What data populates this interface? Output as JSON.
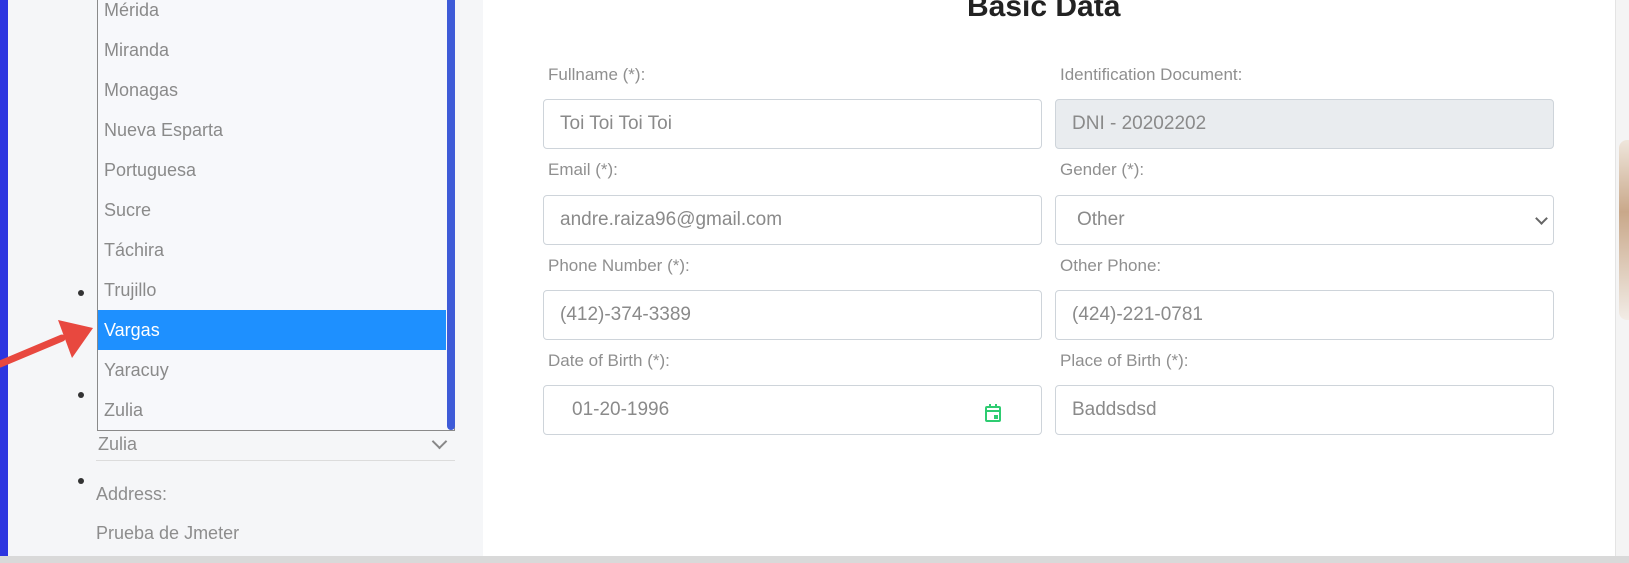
{
  "dropdown": {
    "options": [
      "Mérida",
      "Miranda",
      "Monagas",
      "Nueva Esparta",
      "Portuguesa",
      "Sucre",
      "Táchira",
      "Trujillo",
      "Vargas",
      "Yaracuy",
      "Zulia"
    ],
    "selected": "Vargas"
  },
  "sidebar": {
    "state_select_value": "Zulia",
    "address_label": "Address:",
    "address_value": "Prueba de Jmeter"
  },
  "form": {
    "title": "Basic Data",
    "fullname": {
      "label": "Fullname (*):",
      "value": "Toi Toi Toi Toi"
    },
    "identification": {
      "label": "Identification Document:",
      "value": "DNI - 20202202"
    },
    "email": {
      "label": "Email (*):",
      "value": "andre.raiza96@gmail.com"
    },
    "gender": {
      "label": "Gender (*):",
      "value": "Other"
    },
    "phone": {
      "label": "Phone Number (*):",
      "value": "(412)-374-3389"
    },
    "other_phone": {
      "label": "Other Phone:",
      "value": "(424)-221-0781"
    },
    "birth_date": {
      "label": "Date of Birth (*):",
      "value": "01-20-1996"
    },
    "birth_place": {
      "label": "Place of Birth (*):",
      "value": "Baddsdsd"
    }
  },
  "colors": {
    "accent_blue": "#1e90ff",
    "annotation_arrow": "#e8483f",
    "calendar_icon": "#2ecc71"
  }
}
